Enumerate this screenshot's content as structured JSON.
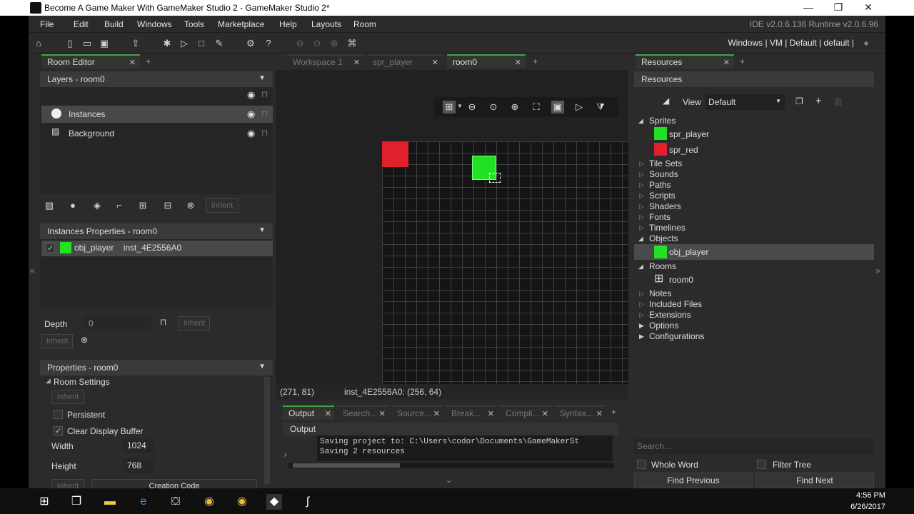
{
  "window": {
    "title": "Become A Game Maker With GameMaker Studio 2 - GameMaker Studio 2*"
  },
  "menu": [
    "File",
    "Edit",
    "Build",
    "Windows",
    "Tools",
    "Marketplace",
    "Help",
    "Layouts",
    "Room"
  ],
  "ide_version": "IDE v2.0.6.136 Runtime v2.0.6.96",
  "target_bar": "Windows | VM | Default | default |",
  "left_tabs": [
    "Room Editor"
  ],
  "layers": {
    "header": "Layers - room0",
    "items": [
      "Instances",
      "Background"
    ]
  },
  "layer_inherit": "Inherit",
  "instances": {
    "header": "Instances Properties - room0",
    "item_name": "obj_player",
    "item_id": "inst_4E2556A0"
  },
  "depth": {
    "label": "Depth",
    "value": "0",
    "inherit": "Inherit",
    "inherit2": "Inherit"
  },
  "properties": {
    "header": "Properties - room0",
    "section": "Room Settings",
    "inherit": "Inherit",
    "persistent": "Persistent",
    "clear": "Clear Display Buffer",
    "width_label": "Width",
    "width": "1024",
    "height_label": "Height",
    "height": "768",
    "inherit3": "Inherit",
    "creation": "Creation Code"
  },
  "mid_tabs": [
    "Workspace 1",
    "spr_player",
    "room0"
  ],
  "status": {
    "coords": "(271, 81)",
    "instance": "inst_4E2556A0: (256, 64)"
  },
  "output": {
    "tabs": [
      "Output",
      "Search...",
      "Source...",
      "Break...",
      "Compil...",
      "Syntax..."
    ],
    "header": "Output",
    "lines": "Saving project to: C:\\Users\\codor\\Documents\\GameMakerSt\nSaving 2 resources"
  },
  "right_tabs": [
    "Resources"
  ],
  "resources": {
    "header": "Resources",
    "view_label": "View",
    "view_value": "Default",
    "sprites": "Sprites",
    "spr_player": "spr_player",
    "spr_red": "spr_red",
    "groups1": [
      "Tile Sets",
      "Sounds",
      "Paths",
      "Scripts",
      "Shaders",
      "Fonts",
      "Timelines"
    ],
    "objects": "Objects",
    "obj_player": "obj_player",
    "rooms": "Rooms",
    "room0": "room0",
    "groups2": [
      "Notes",
      "Included Files",
      "Extensions",
      "Options",
      "Configurations"
    ],
    "search_placeholder": "Search...",
    "whole_word": "Whole Word",
    "filter_tree": "Filter Tree",
    "find_prev": "Find Previous",
    "find_next": "Find Next"
  },
  "colors": {
    "player": "#22e022",
    "red": "#e0202a",
    "accent": "#3fa63f"
  },
  "clock": {
    "time": "4:56 PM",
    "date": "6/26/2017"
  }
}
